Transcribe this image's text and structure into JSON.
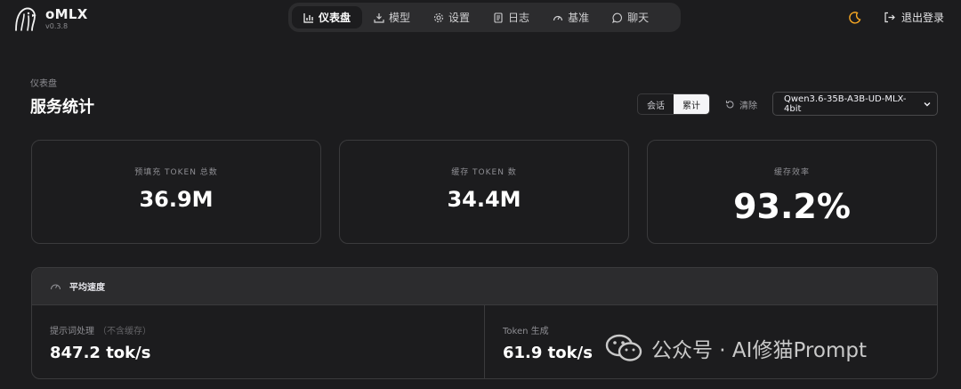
{
  "app": {
    "name": "oMLX",
    "version": "v0.3.8"
  },
  "nav": {
    "items": [
      {
        "label": "仪表盘",
        "icon": "bar-chart-icon",
        "active": true
      },
      {
        "label": "模型",
        "icon": "download-icon",
        "active": false
      },
      {
        "label": "设置",
        "icon": "gear-icon",
        "active": false
      },
      {
        "label": "日志",
        "icon": "document-icon",
        "active": false
      },
      {
        "label": "基准",
        "icon": "gauge-icon",
        "active": false
      },
      {
        "label": "聊天",
        "icon": "chat-bubble-icon",
        "active": false
      }
    ]
  },
  "header": {
    "theme_icon": "moon-icon",
    "logout_label": "退出登录"
  },
  "page": {
    "breadcrumb": "仪表盘",
    "title": "服务统计",
    "scope": {
      "options": [
        "会话",
        "累计"
      ],
      "selected": "累计"
    },
    "clear_label": "清除",
    "model_select": {
      "value": "Qwen3.6-35B-A3B-UD-MLX-4bit"
    }
  },
  "stats": [
    {
      "label": "预填充 TOKEN 总数",
      "value": "36.9M"
    },
    {
      "label": "缓存 TOKEN 数",
      "value": "34.4M"
    },
    {
      "label": "缓存效率",
      "value": "93.2%"
    }
  ],
  "speed": {
    "title": "平均速度",
    "prompt": {
      "label": "提示词处理",
      "note": "（不含缓存）",
      "value": "847.2 tok/s"
    },
    "generation": {
      "label": "Token 生成",
      "value": "61.9 tok/s"
    }
  },
  "watermark": {
    "text": "公众号 · AI修猫Prompt"
  },
  "colors": {
    "background": "#1c1c1e",
    "panel": "#2c2c2e",
    "border": "#3a3a3c",
    "accent_moon": "#f5a623"
  }
}
